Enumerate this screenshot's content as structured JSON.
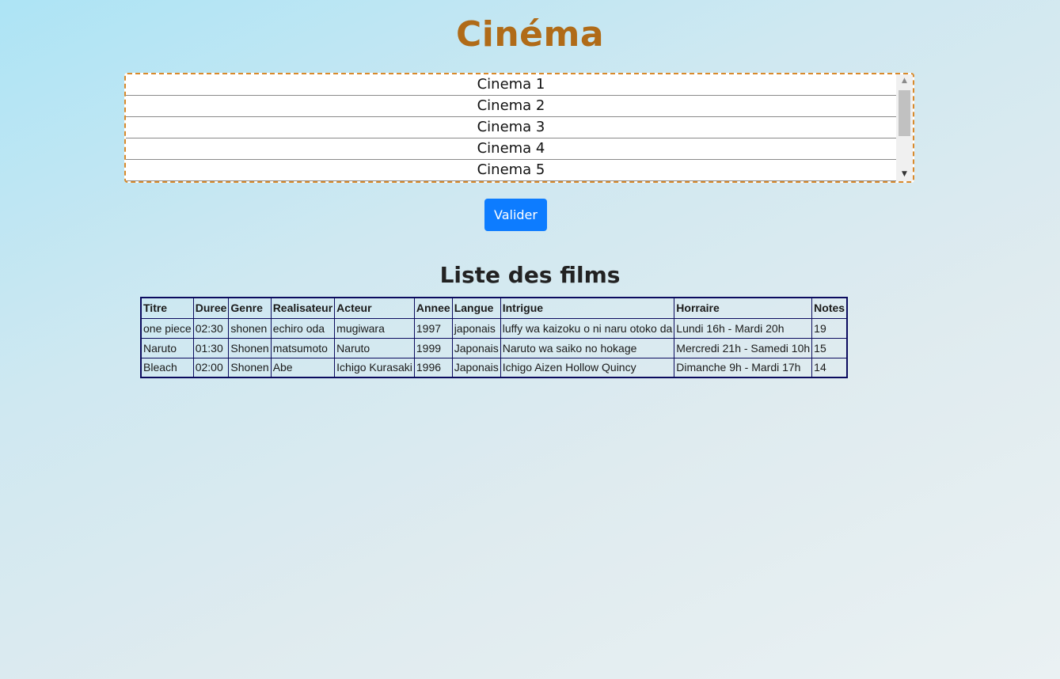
{
  "header": {
    "title": "Cinéma"
  },
  "cinema_select": {
    "options": [
      "Cinema 1",
      "Cinema 2",
      "Cinema 3",
      "Cinema 4",
      "Cinema 5"
    ]
  },
  "form": {
    "submit_label": "Valider"
  },
  "films": {
    "title": "Liste des films",
    "columns": [
      "Titre",
      "Duree",
      "Genre",
      "Realisateur",
      "Acteur",
      "Annee",
      "Langue",
      "Intrigue",
      "Horraire",
      "Notes"
    ],
    "rows": [
      [
        "one piece",
        "02:30",
        "shonen",
        "echiro oda",
        "mugiwara",
        "1997",
        "japonais",
        "luffy wa kaizoku o ni naru otoko da",
        "Lundi 16h - Mardi 20h",
        "19"
      ],
      [
        "Naruto",
        "01:30",
        "Shonen",
        "matsumoto",
        "Naruto",
        "1999",
        "Japonais",
        "Naruto wa saiko no hokage",
        "Mercredi 21h - Samedi 10h",
        "15"
      ],
      [
        "Bleach",
        "02:00",
        "Shonen",
        "Abe",
        "Ichigo Kurasaki",
        "1996",
        "Japonais",
        "Ichigo Aizen Hollow Quincy",
        "Dimanche 9h - Mardi 17h",
        "14"
      ]
    ]
  },
  "icons": {
    "scroll_up": "triangle-up-icon",
    "scroll_down": "triangle-down-icon"
  },
  "colors": {
    "title": "#b06b18",
    "select_border": "#d98a2c",
    "button": "#0d7cff",
    "table_border": "#0b0b5e"
  }
}
